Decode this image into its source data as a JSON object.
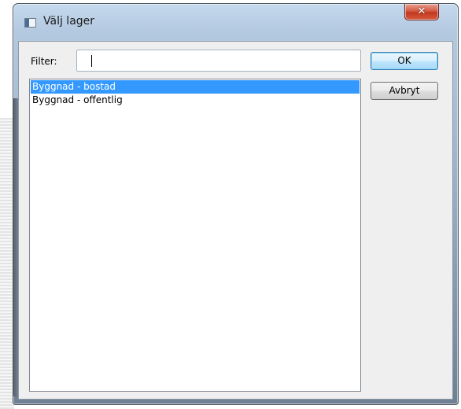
{
  "window": {
    "title": "Välj lager",
    "icon": "window-app-icon",
    "close_symbol": "✕"
  },
  "filter": {
    "label": "Filter:",
    "value": "",
    "placeholder": ""
  },
  "layers": {
    "items": [
      {
        "label": "Byggnad - bostad",
        "selected": true
      },
      {
        "label": "Byggnad - offentlig",
        "selected": false
      }
    ]
  },
  "buttons": {
    "ok_label": "OK",
    "cancel_label": "Avbryt"
  },
  "colors": {
    "selection": "#3399ff",
    "dialog_background": "#efefef",
    "close_button": "#c0391f"
  }
}
